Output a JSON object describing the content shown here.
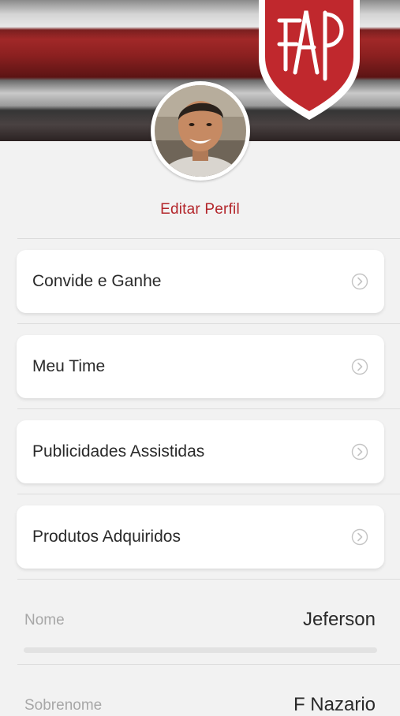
{
  "brand": {
    "logo_text": "FAP",
    "accent_color": "#b3262b"
  },
  "profile": {
    "edit_label": "Editar Perfil",
    "avatar_alt": "Foto de perfil"
  },
  "menu": [
    {
      "label": "Convide e Ganhe",
      "icon": "chevron-right-circle-icon"
    },
    {
      "label": "Meu Time",
      "icon": "chevron-right-circle-icon"
    },
    {
      "label": "Publicidades Assistidas",
      "icon": "chevron-right-circle-icon"
    },
    {
      "label": "Produtos Adquiridos",
      "icon": "chevron-right-circle-icon"
    }
  ],
  "fields": [
    {
      "label": "Nome",
      "value": "Jeferson"
    },
    {
      "label": "Sobrenome",
      "value": "F Nazario"
    }
  ]
}
